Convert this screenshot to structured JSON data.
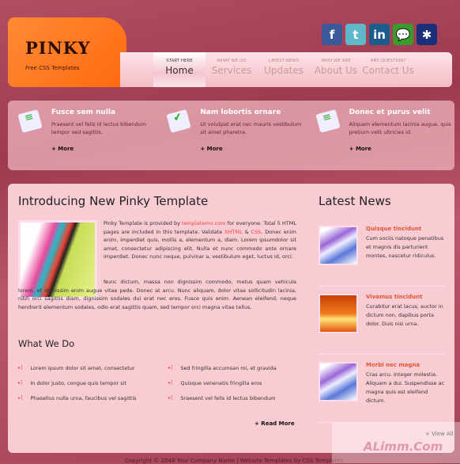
{
  "logo": {
    "title": "PINKY",
    "subtitle": "Free CSS Templates"
  },
  "nav": [
    {
      "small": "Start Here",
      "label": "Home"
    },
    {
      "small": "What We Do",
      "label": "Services"
    },
    {
      "small": "Latest News",
      "label": "Updates"
    },
    {
      "small": "Who We Are",
      "label": "About Us"
    },
    {
      "small": "Any Question?",
      "label": "Contact Us"
    }
  ],
  "social": [
    {
      "icon": "facebook-icon",
      "glyph": "f",
      "color": "#3b5998"
    },
    {
      "icon": "twitter-icon",
      "glyph": "t",
      "color": "#5fb7c9"
    },
    {
      "icon": "linkedin-icon",
      "glyph": "in",
      "color": "#1c5b8c"
    },
    {
      "icon": "chat-icon",
      "glyph": "💬",
      "color": "#3a9a2a"
    },
    {
      "icon": "myspace-icon",
      "glyph": "✱",
      "color": "#1b2f7a"
    }
  ],
  "features": [
    {
      "title": "Fusce sem nulla",
      "text": "Praesent vel felis id lectus bibendum tempor sed sagittis.",
      "more": "+ More"
    },
    {
      "title": "Nam lobortis ornare",
      "text": "Ut volutpat erat nec mauris vestibulum sit amet pharetra.",
      "more": "+ More"
    },
    {
      "title": "Donec et purus velit",
      "text": "Aliquam elementum lacinia augue, quis pretium velit ultricies id.",
      "more": "+ More"
    }
  ],
  "intro": {
    "title": "Introducing New Pinky Template",
    "p1_a": "Pinky Template is provided by ",
    "p1_link": "templatemo.com",
    "p1_b": " for everyone. Total 5 HTML pages are included in this template. Validate ",
    "xhtml": "XHTML",
    "amp": " & ",
    "css": "CSS",
    "p1_c": ". Donec enim enim, imperdiet quis, mollis a, elementum a, diam. Lorem ipsumdolor sit amet, consectetur adipiscing elit. Nulla et nunc commodo ante ornare imperdiet. Donec nunc neque, pulvinar a, vestibulum eget, luctus id, orci.",
    "p2": "Nunc dictum, massa non dignissim commodo, metus quam vehicula lorem, et dignissim enim augue vitae pede. Donec at arcu. Nunc aliquam, dolor vitae sollicitudin lacinia, nibh orci sagittis diam, dignissim sodales dui erat nec eros. Fusce quis enim. Aenean eleifend, neque hendrerit elementum sodales, odio erat sagittis quam, sed tempor orci magna vitae tellus."
  },
  "what": {
    "title": "What We Do",
    "col1": [
      "Lorem ipsum dolor sit amet, consectetur",
      "In dolor justo, congue quis tempor sit",
      "Phasellus nulla urna, faucibus vel sagittis"
    ],
    "col2": [
      "Sed fringilla accumsan mi, et gravida",
      "Quisque venenatis fringilla eros",
      "Sraesent vel felis id lectus bibendum"
    ],
    "read_more": "+ Read More"
  },
  "news": {
    "title": "Latest News",
    "items": [
      {
        "title": "Quisque tincidunt",
        "text": "Cum sociis natoque penatibus et magnis dis parturient montes, nascetur ridiculus.",
        "thumb": "purple"
      },
      {
        "title": "Vivamus tincidunt",
        "text": "Curabitur erat lacus, auctor in dictum non, dapibus porta dolor. Duis nisi urna.",
        "thumb": "orange"
      },
      {
        "title": "Morbi nec magna",
        "text": "Cras arcu. Integer molestie. Aliquam a dui. Suspendisse ac magna quis est eleifend dictum.",
        "thumb": "purple"
      }
    ],
    "view_all": "+ View All"
  },
  "footer": "Copyright © 2048 Your Company Name | Website Templates by CSS Templates",
  "watermark": "ALimm.Com"
}
